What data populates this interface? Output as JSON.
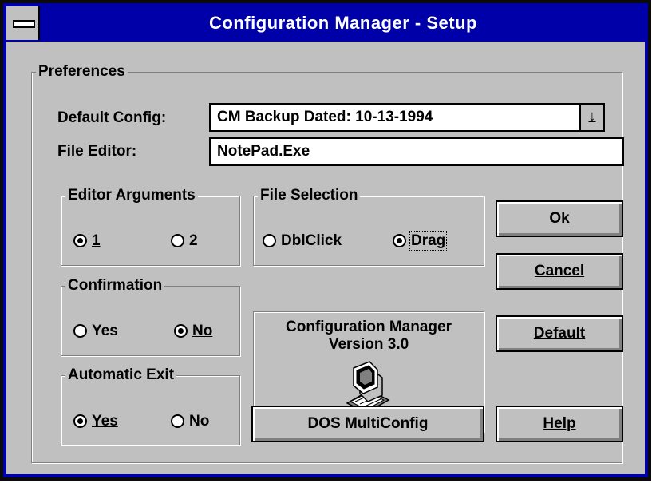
{
  "window": {
    "title": "Configuration Manager - Setup"
  },
  "preferences": {
    "group_title": "Preferences",
    "default_config_label": "Default Config:",
    "default_config_value": "CM Backup Dated: 10-13-1994",
    "file_editor_label": "File Editor:",
    "file_editor_value": "NotePad.Exe"
  },
  "editor_arguments": {
    "title": "Editor Arguments",
    "options": [
      {
        "label": "1",
        "selected": true
      },
      {
        "label": "2",
        "selected": false
      }
    ]
  },
  "file_selection": {
    "title": "File Selection",
    "options": [
      {
        "label": "DblClick",
        "selected": false
      },
      {
        "label": "Drag",
        "selected": true
      }
    ]
  },
  "confirmation": {
    "title": "Confirmation",
    "options": [
      {
        "label": "Yes",
        "selected": false
      },
      {
        "label": "No",
        "selected": true
      }
    ]
  },
  "automatic_exit": {
    "title": "Automatic Exit",
    "options": [
      {
        "label": "Yes",
        "selected": true
      },
      {
        "label": "No",
        "selected": false
      }
    ]
  },
  "about": {
    "line1": "Configuration Manager",
    "line2": "Version 3.0",
    "icon": "computer-icon"
  },
  "buttons": {
    "ok": "Ok",
    "cancel": "Cancel",
    "default": "Default",
    "help": "Help",
    "dos_multiconfig": "DOS MultiConfig"
  },
  "colors": {
    "titlebar": "#0000a8",
    "face": "#c0c0c0"
  }
}
